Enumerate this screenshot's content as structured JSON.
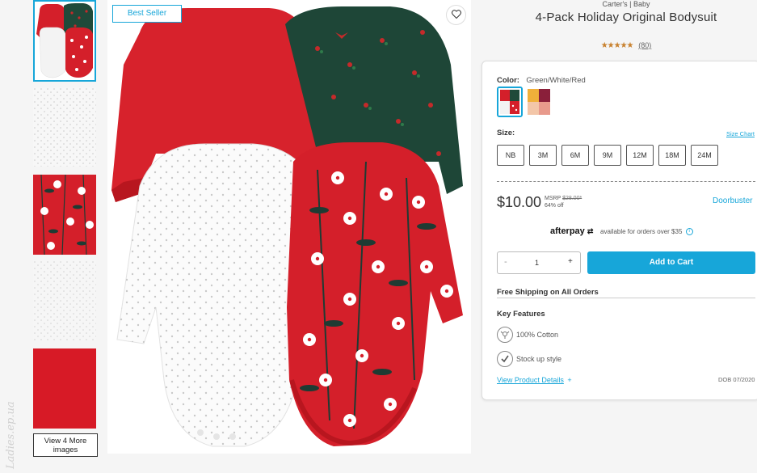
{
  "thumbnails": {
    "items": [
      "front-view",
      "white-dots-detail",
      "red-floral-detail",
      "white-dots-detail-2",
      "red-solid-detail"
    ],
    "view_more_line1": "View 4 More",
    "view_more_line2": "images",
    "watermark": "Ladies.ep.ua"
  },
  "main_image": {
    "badge": "Best Seller",
    "favorite_icon": "heart-icon"
  },
  "product": {
    "brand": "Carter's | Baby",
    "title": "4-Pack Holiday Original Bodysuit",
    "stars": "★★★★★",
    "review_count": "(80)",
    "star_color": "#c8812e"
  },
  "purchase": {
    "color_label": "Color:",
    "color_value": "Green/White/Red",
    "size_label": "Size:",
    "size_chart": "Size Chart",
    "sizes": [
      "NB",
      "3M",
      "6M",
      "9M",
      "12M",
      "18M",
      "24M"
    ],
    "price": "$10.00",
    "msrp_label": "MSRP",
    "msrp_value": "$28.00*",
    "discount": "64% off",
    "doorbuster": "Doorbuster",
    "afterpay_brand": "afterpay",
    "afterpay_note": "available for orders over $35",
    "qty_minus": "-",
    "qty_value": "1",
    "qty_plus": "+",
    "add_to_cart": "Add to Cart",
    "accent_color": "#17a6d9"
  },
  "details": {
    "shipping": "Free Shipping on All Orders",
    "key_features_title": "Key Features",
    "features": [
      "100% Cotton",
      "Stock up style"
    ],
    "view_details": "View Product Details",
    "view_details_plus": "+",
    "date_code": "DOB 07/2020"
  }
}
